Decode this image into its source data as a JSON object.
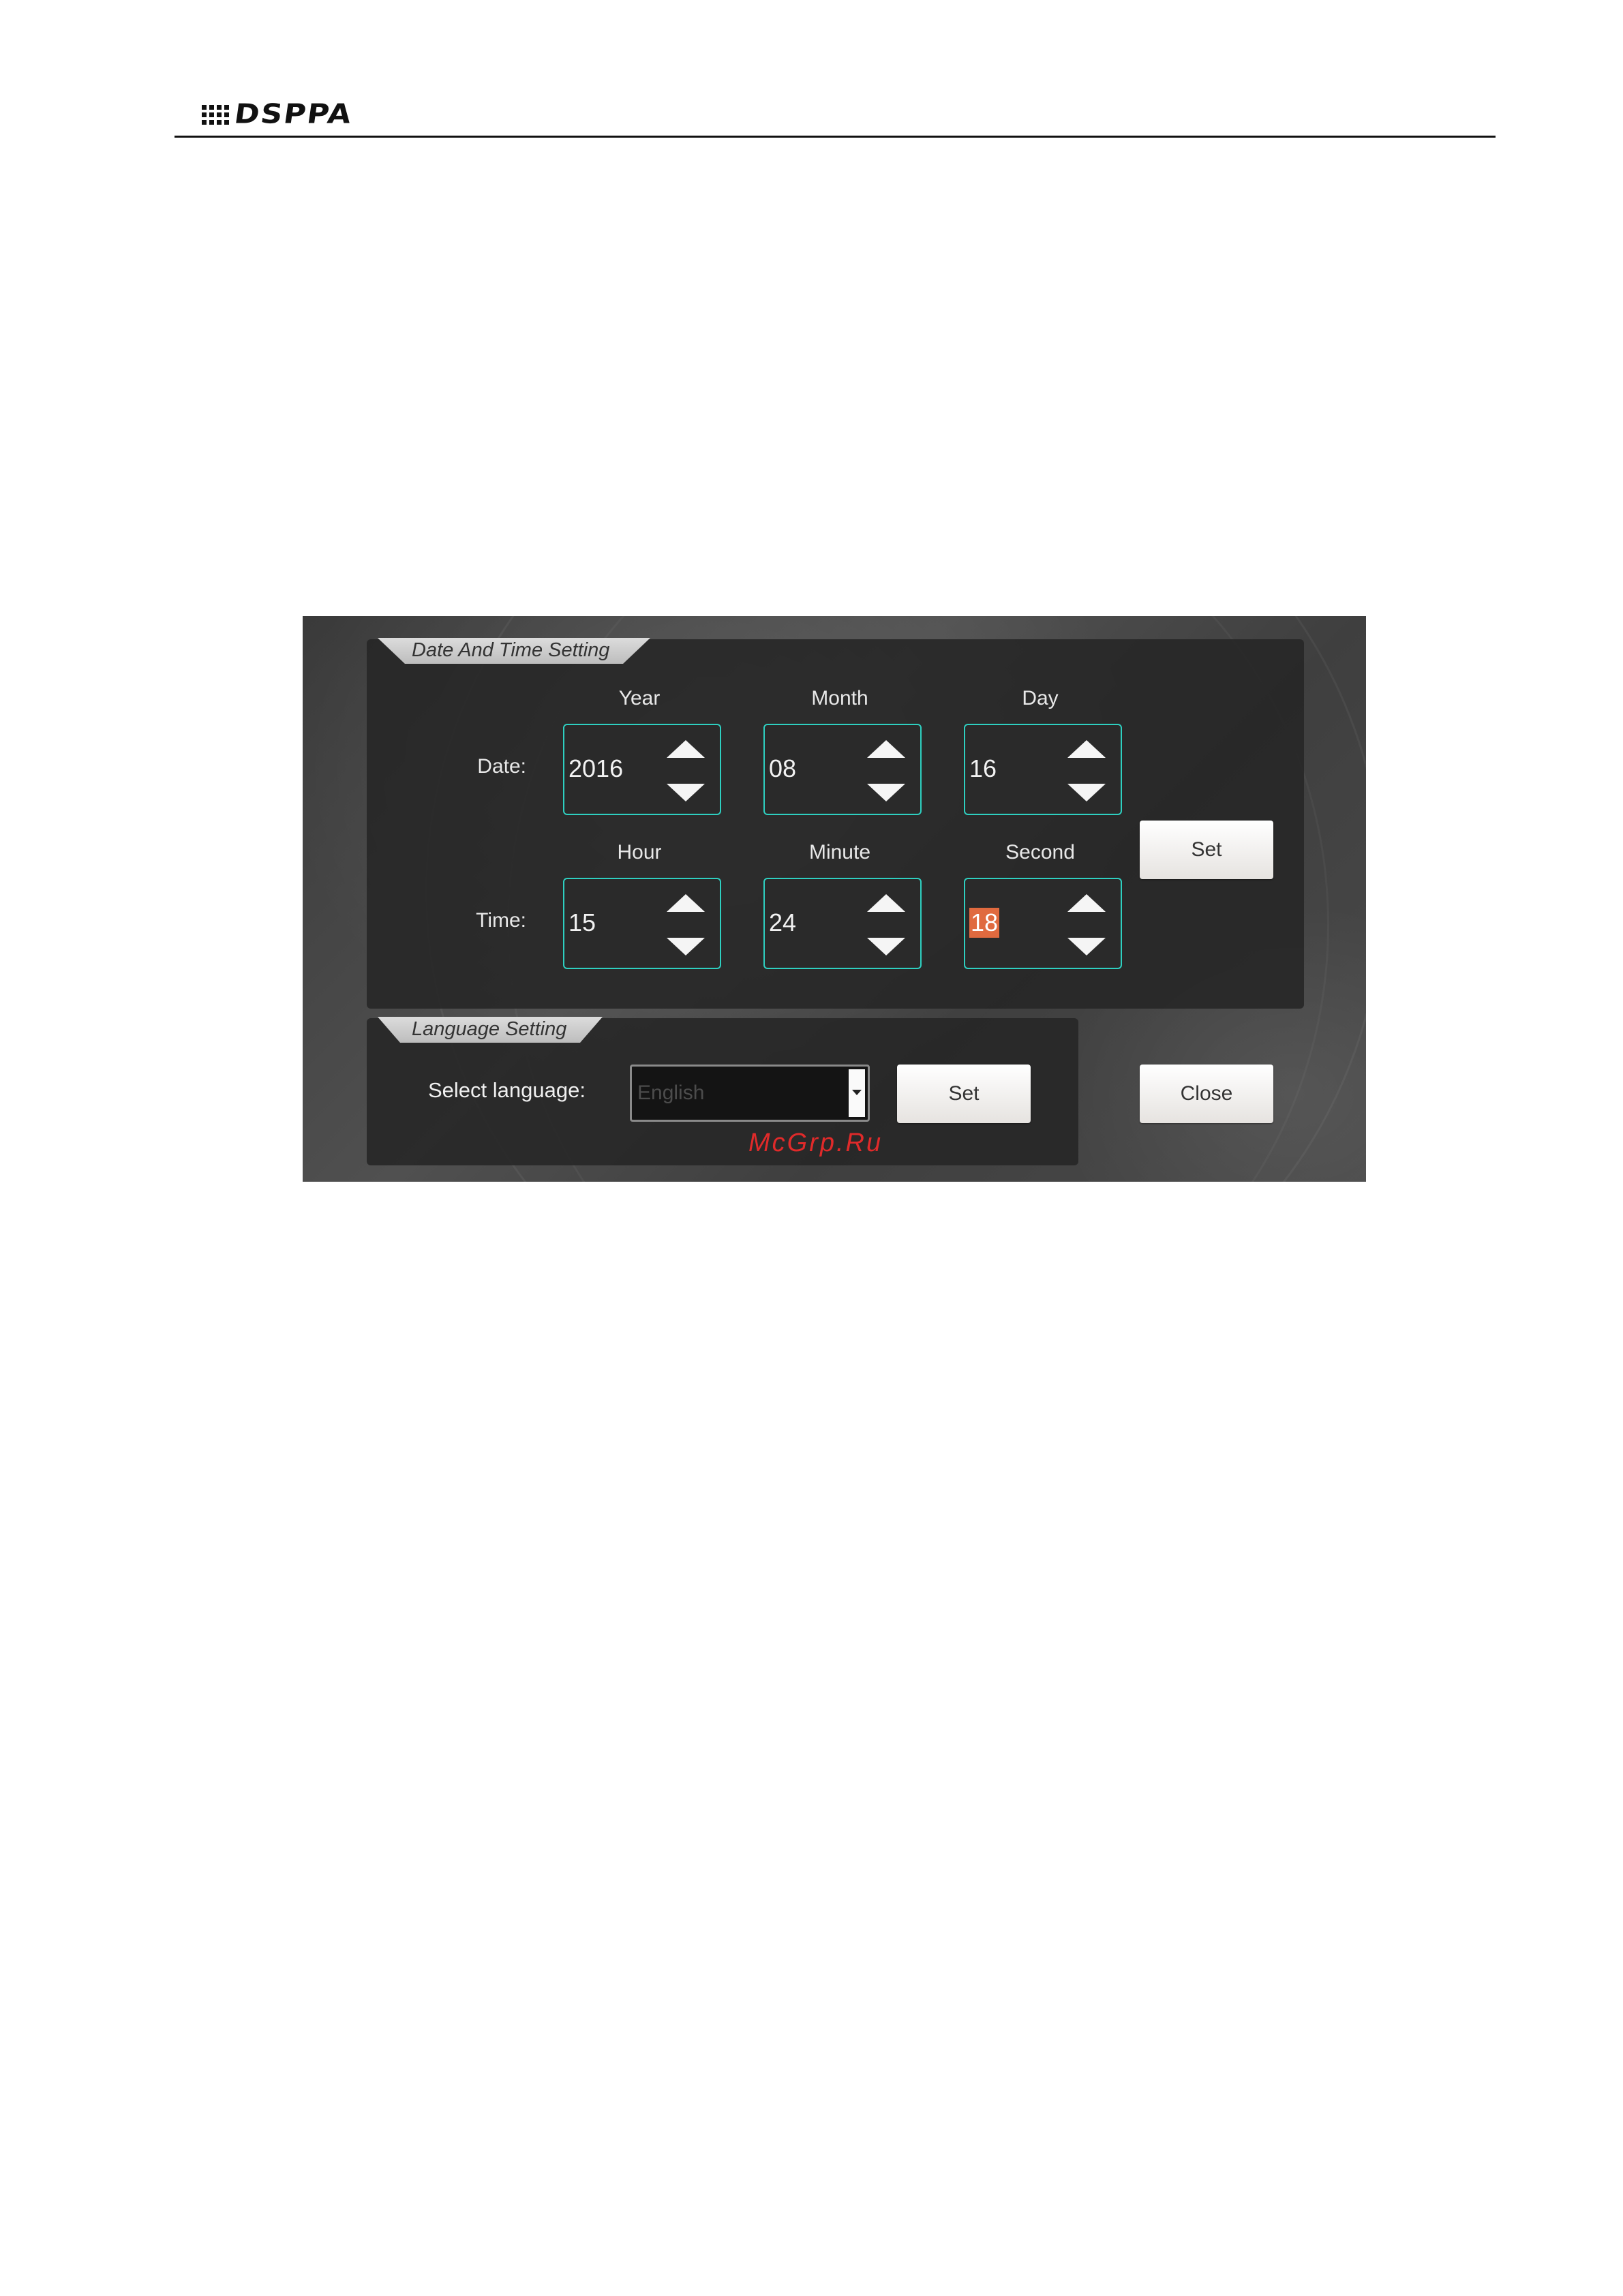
{
  "header": {
    "brand": "DSPPA"
  },
  "datetime_panel": {
    "title": "Date And Time Setting",
    "date_label": "Date:",
    "time_label": "Time:",
    "date_fields": [
      {
        "label": "Year",
        "value": "2016"
      },
      {
        "label": "Month",
        "value": "08"
      },
      {
        "label": "Day",
        "value": "16"
      }
    ],
    "time_fields": [
      {
        "label": "Hour",
        "value": "15"
      },
      {
        "label": "Minute",
        "value": "24"
      },
      {
        "label": "Second",
        "value": "18"
      }
    ],
    "set_label": "Set"
  },
  "language_panel": {
    "title": "Language Setting",
    "select_label": "Select language:",
    "selected_language": "English",
    "set_label": "Set"
  },
  "close_label": "Close",
  "watermark": "McGrp.Ru",
  "colors": {
    "spinner_border": "#2ecfc0",
    "selection_highlight": "#e06a3f",
    "watermark": "#e02a2a"
  }
}
